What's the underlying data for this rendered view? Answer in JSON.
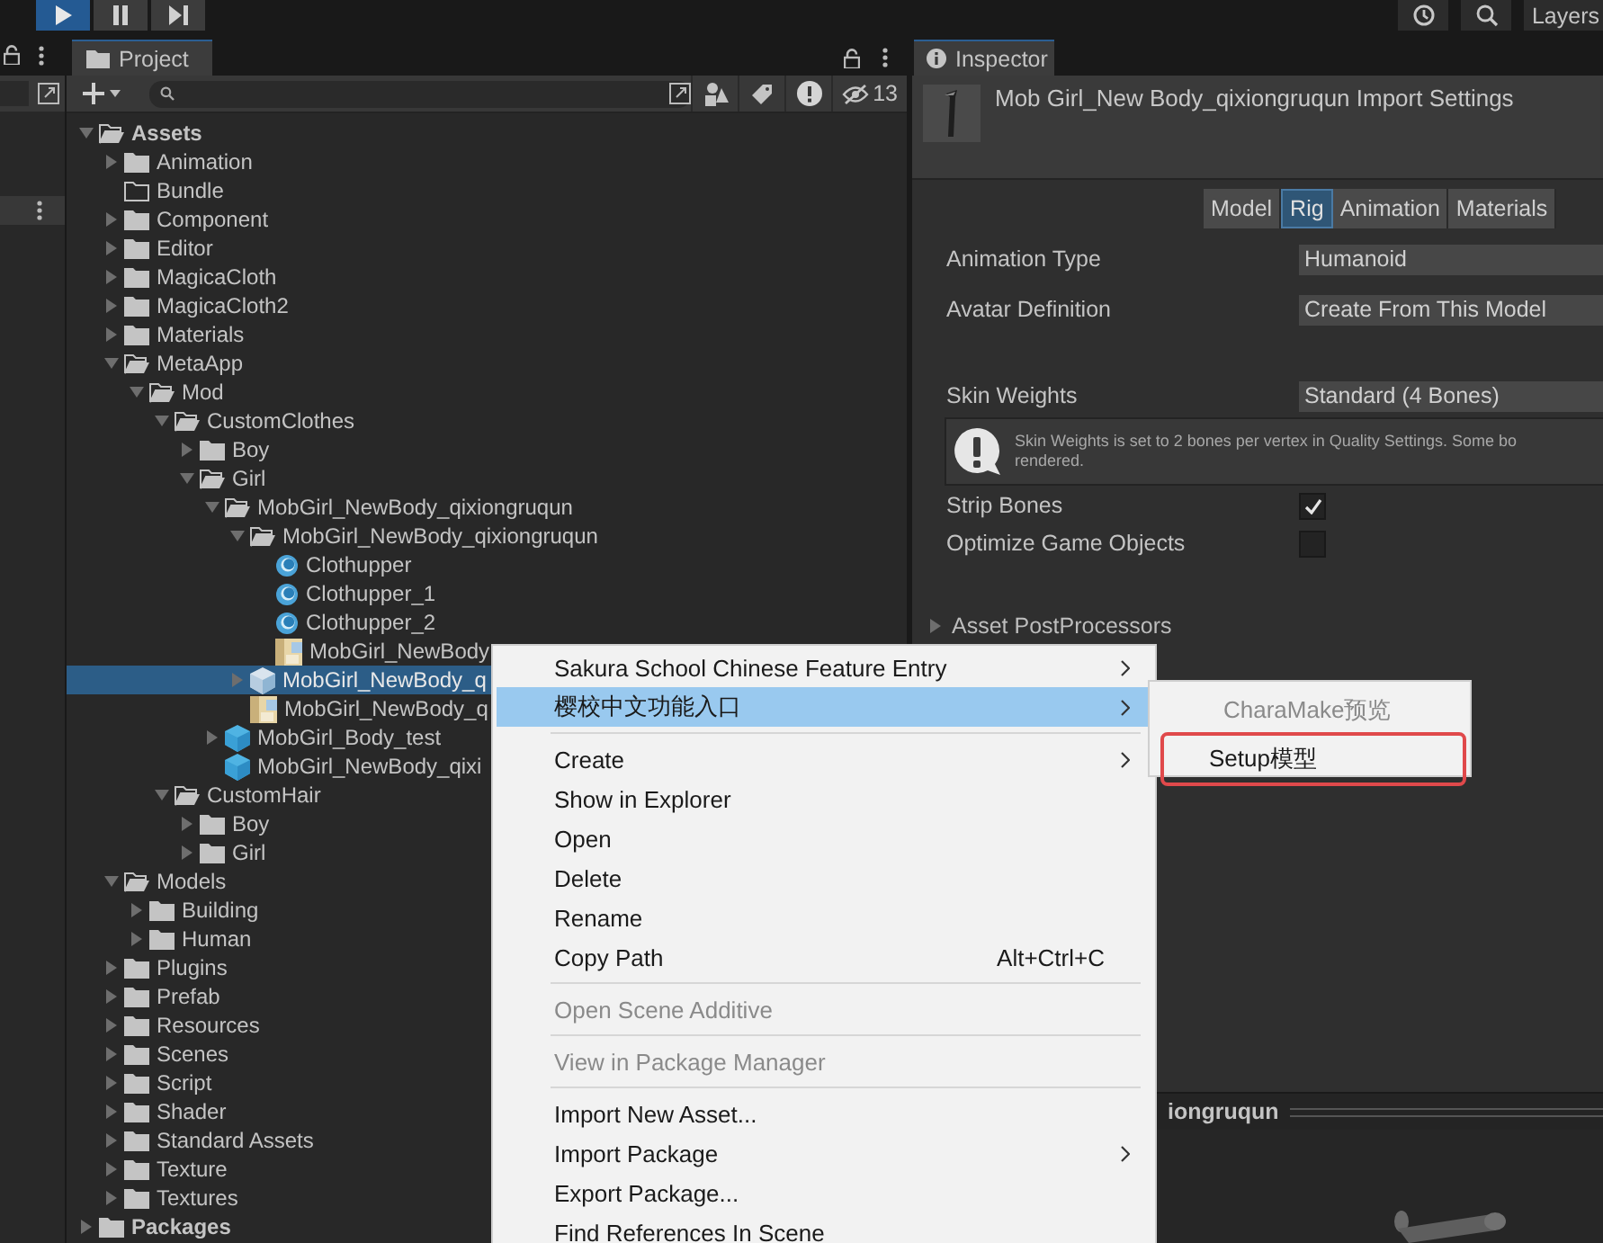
{
  "toolbar": {
    "playing": true,
    "layers_label": "Layers"
  },
  "project": {
    "tab": "Project",
    "hidden_count": "13",
    "tree": [
      {
        "label": "Assets",
        "kind": "folder",
        "expanded": true,
        "selected": false,
        "children": [
          {
            "label": "Animation",
            "kind": "folder",
            "expanded": false,
            "selected": false
          },
          {
            "label": "Bundle",
            "kind": "empty-folder",
            "selected": false
          },
          {
            "label": "Component",
            "kind": "folder",
            "expanded": false,
            "selected": false
          },
          {
            "label": "Editor",
            "kind": "folder",
            "expanded": false,
            "selected": false
          },
          {
            "label": "MagicaCloth",
            "kind": "folder",
            "expanded": false,
            "selected": false
          },
          {
            "label": "MagicaCloth2",
            "kind": "folder",
            "expanded": false,
            "selected": false
          },
          {
            "label": "Materials",
            "kind": "folder",
            "expanded": false,
            "selected": false
          },
          {
            "label": "MetaApp",
            "kind": "folder",
            "expanded": true,
            "selected": false,
            "children": [
              {
                "label": "Mod",
                "kind": "folder",
                "expanded": true,
                "selected": false,
                "children": [
                  {
                    "label": "CustomClothes",
                    "kind": "folder",
                    "expanded": true,
                    "selected": false,
                    "children": [
                      {
                        "label": "Boy",
                        "kind": "folder",
                        "expanded": false,
                        "selected": false
                      },
                      {
                        "label": "Girl",
                        "kind": "folder",
                        "expanded": true,
                        "selected": false,
                        "children": [
                          {
                            "label": "MobGirl_NewBody_qixiongruqun",
                            "kind": "folder",
                            "expanded": true,
                            "selected": false,
                            "children": [
                              {
                                "label": "MobGirl_NewBody_qixiongruqun",
                                "kind": "folder",
                                "expanded": true,
                                "selected": false,
                                "children": [
                                  {
                                    "label": "Clothupper",
                                    "kind": "cloth",
                                    "selected": false
                                  },
                                  {
                                    "label": "Clothupper_1",
                                    "kind": "cloth",
                                    "selected": false
                                  },
                                  {
                                    "label": "Clothupper_2",
                                    "kind": "cloth",
                                    "selected": false
                                  },
                                  {
                                    "label": "MobGirl_NewBody",
                                    "kind": "texture",
                                    "selected": false
                                  }
                                ]
                              },
                              {
                                "label": "MobGirl_NewBody_q",
                                "kind": "model",
                                "expanded": false,
                                "selected": true
                              },
                              {
                                "label": "MobGirl_NewBody_q",
                                "kind": "texture",
                                "selected": false
                              }
                            ]
                          },
                          {
                            "label": "MobGirl_Body_test",
                            "kind": "model",
                            "expanded": false,
                            "selected": false
                          },
                          {
                            "label": "MobGirl_NewBody_qixi",
                            "kind": "model",
                            "selected": false
                          }
                        ]
                      }
                    ]
                  },
                  {
                    "label": "CustomHair",
                    "kind": "folder",
                    "expanded": true,
                    "selected": false,
                    "children": [
                      {
                        "label": "Boy",
                        "kind": "folder",
                        "expanded": false,
                        "selected": false
                      },
                      {
                        "label": "Girl",
                        "kind": "folder",
                        "expanded": false,
                        "selected": false
                      }
                    ]
                  }
                ]
              }
            ]
          },
          {
            "label": "Models",
            "kind": "folder",
            "expanded": true,
            "selected": false,
            "children": [
              {
                "label": "Building",
                "kind": "folder",
                "expanded": false,
                "selected": false
              },
              {
                "label": "Human",
                "kind": "folder",
                "expanded": false,
                "selected": false
              }
            ]
          },
          {
            "label": "Plugins",
            "kind": "folder",
            "expanded": false,
            "selected": false
          },
          {
            "label": "Prefab",
            "kind": "folder",
            "expanded": false,
            "selected": false
          },
          {
            "label": "Resources",
            "kind": "folder",
            "expanded": false,
            "selected": false
          },
          {
            "label": "Scenes",
            "kind": "folder",
            "expanded": false,
            "selected": false
          },
          {
            "label": "Script",
            "kind": "folder",
            "expanded": false,
            "selected": false
          },
          {
            "label": "Shader",
            "kind": "folder",
            "expanded": false,
            "selected": false
          },
          {
            "label": "Standard Assets",
            "kind": "folder",
            "expanded": false,
            "selected": false
          },
          {
            "label": "Texture",
            "kind": "folder",
            "expanded": false,
            "selected": false
          },
          {
            "label": "Textures",
            "kind": "folder",
            "expanded": false,
            "selected": false
          }
        ]
      },
      {
        "label": "Packages",
        "kind": "folder",
        "expanded": false,
        "selected": false
      }
    ]
  },
  "inspector": {
    "tab": "Inspector",
    "title": "Mob Girl_New Body_qixiongruqun Import Settings",
    "tabs": [
      {
        "label": "Model",
        "selected": false
      },
      {
        "label": "Rig",
        "selected": true
      },
      {
        "label": "Animation",
        "selected": false
      },
      {
        "label": "Materials",
        "selected": false
      }
    ],
    "groups": [
      [
        {
          "kind": "dropdown",
          "label": "Animation Type",
          "value": "Humanoid"
        },
        {
          "kind": "dropdown",
          "label": "Avatar Definition",
          "value": "Create From This Model"
        }
      ],
      [
        {
          "kind": "dropdown",
          "label": "Skin Weights",
          "value": "Standard (4 Bones)"
        },
        {
          "kind": "help",
          "lines": [
            "Skin Weights is set to 2 bones per vertex in Quality Settings. Some bo",
            "rendered."
          ]
        },
        {
          "kind": "checkbox",
          "label": "Strip Bones",
          "checked": true
        },
        {
          "kind": "checkbox",
          "label": "Optimize Game Objects",
          "checked": false
        }
      ]
    ],
    "section": {
      "label": "Asset PostProcessors",
      "expanded": false
    },
    "preview_title": "iongruqun"
  },
  "context_menu": {
    "items": [
      {
        "kind": "item",
        "label": "Sakura School Chinese Feature Entry",
        "submenu": true,
        "highlighted": false,
        "disabled": false
      },
      {
        "kind": "item",
        "label": "樱校中文功能入口",
        "submenu": true,
        "highlighted": true,
        "disabled": false
      },
      {
        "kind": "separator"
      },
      {
        "kind": "item",
        "label": "Create",
        "submenu": true,
        "highlighted": false,
        "disabled": false
      },
      {
        "kind": "item",
        "label": "Show in Explorer",
        "submenu": false,
        "highlighted": false,
        "disabled": false
      },
      {
        "kind": "item",
        "label": "Open",
        "submenu": false,
        "highlighted": false,
        "disabled": false
      },
      {
        "kind": "item",
        "label": "Delete",
        "submenu": false,
        "highlighted": false,
        "disabled": false
      },
      {
        "kind": "item",
        "label": "Rename",
        "submenu": false,
        "highlighted": false,
        "disabled": false
      },
      {
        "kind": "item",
        "label": "Copy Path",
        "shortcut": "Alt+Ctrl+C",
        "submenu": false,
        "highlighted": false,
        "disabled": false
      },
      {
        "kind": "separator"
      },
      {
        "kind": "item",
        "label": "Open Scene Additive",
        "submenu": false,
        "highlighted": false,
        "disabled": true
      },
      {
        "kind": "separator"
      },
      {
        "kind": "item",
        "label": "View in Package Manager",
        "submenu": false,
        "highlighted": false,
        "disabled": true
      },
      {
        "kind": "separator"
      },
      {
        "kind": "item",
        "label": "Import New Asset...",
        "submenu": false,
        "highlighted": false,
        "disabled": false
      },
      {
        "kind": "item",
        "label": "Import Package",
        "submenu": true,
        "highlighted": false,
        "disabled": false
      },
      {
        "kind": "item",
        "label": "Export Package...",
        "submenu": false,
        "highlighted": false,
        "disabled": false
      },
      {
        "kind": "item",
        "label": "Find References In Scene",
        "submenu": false,
        "highlighted": false,
        "disabled": false
      }
    ]
  },
  "submenu": {
    "items": [
      {
        "label": "CharaMake预览",
        "disabled": true,
        "outlined": false
      },
      {
        "label": "Setup模型",
        "disabled": false,
        "outlined": true
      }
    ]
  }
}
